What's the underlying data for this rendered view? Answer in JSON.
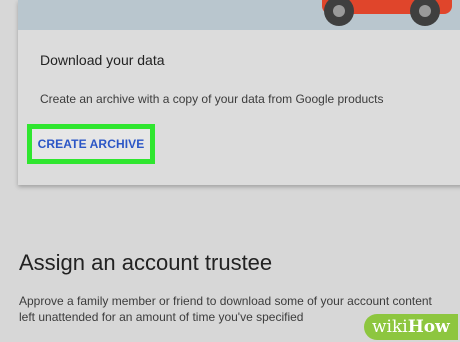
{
  "download_card": {
    "title": "Download your data",
    "description": "Create an archive with a copy of your data from Google products",
    "create_archive_label": "CREATE ARCHIVE",
    "highlight_color": "#2fe62f"
  },
  "trustee_section": {
    "title": "Assign an account trustee",
    "description_line1": "Approve a family member or friend to download some of your account content",
    "description_line2": "left unattended for an amount of time you've specified"
  },
  "watermark": {
    "part1": "wiki",
    "part2": "How"
  }
}
